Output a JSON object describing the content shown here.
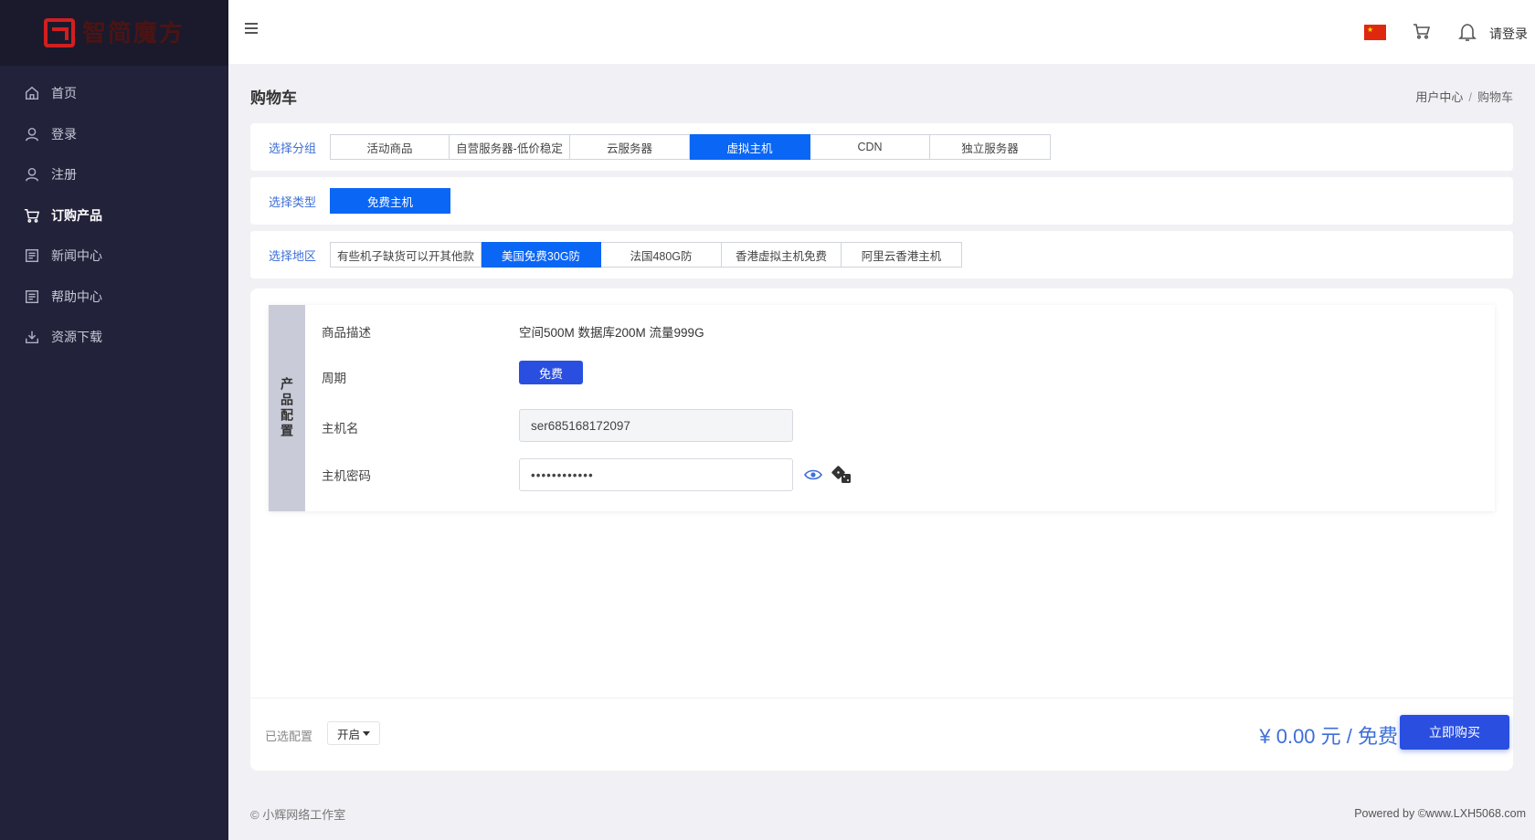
{
  "brand": {
    "name": "智简魔方",
    "tagline": ""
  },
  "sidebar": {
    "items": [
      {
        "label": "首页",
        "icon": "home-icon"
      },
      {
        "label": "登录",
        "icon": "user-icon"
      },
      {
        "label": "注册",
        "icon": "user-icon"
      },
      {
        "label": "订购产品",
        "icon": "cart-icon",
        "active": true
      },
      {
        "label": "新闻中心",
        "icon": "document-icon"
      },
      {
        "label": "帮助中心",
        "icon": "document-icon"
      },
      {
        "label": "资源下载",
        "icon": "download-icon"
      }
    ]
  },
  "header": {
    "login_label": "请登录",
    "flag_icon": "china-flag-icon"
  },
  "page": {
    "title": "购物车",
    "breadcrumb": {
      "parent": "用户中心",
      "separator": "/",
      "current": "购物车"
    }
  },
  "group_row": {
    "label": "选择分组",
    "options": [
      "活动商品",
      "自营服务器-低价稳定",
      "云服务器",
      "虚拟主机",
      "CDN",
      "独立服务器"
    ],
    "selected": "虚拟主机"
  },
  "type_row": {
    "label": "选择类型",
    "options": [
      "免费主机"
    ],
    "selected": "免费主机"
  },
  "region_row": {
    "label": "选择地区",
    "options": [
      "有些机子缺货可以开其他款",
      "美国免费30G防",
      "法国480G防",
      "香港虚拟主机免费",
      "阿里云香港主机"
    ],
    "selected": "美国免费30G防"
  },
  "config": {
    "side_title": "产品配置",
    "desc_label": "商品描述",
    "desc_value": "空间500M 数据库200M 流量999G",
    "period_label": "周期",
    "period_value": "免费",
    "hostname_label": "主机名",
    "hostname_value": "ser685168172097",
    "password_label": "主机密码",
    "password_value": "••••••••••••"
  },
  "summary": {
    "label": "已选配置",
    "toggle_label": "开启",
    "price": "¥ 0.00 元 / 免费",
    "buy_label": "立即购买"
  },
  "footer": {
    "copyright": "© 小辉网络工作室",
    "powered": "Powered by ©www.LXH5068.com"
  },
  "colors": {
    "accent": "#0a66f5",
    "primary_button": "#2a4fe0",
    "sidebar_bg": "#22223a",
    "label_blue": "#3e6fd8"
  }
}
